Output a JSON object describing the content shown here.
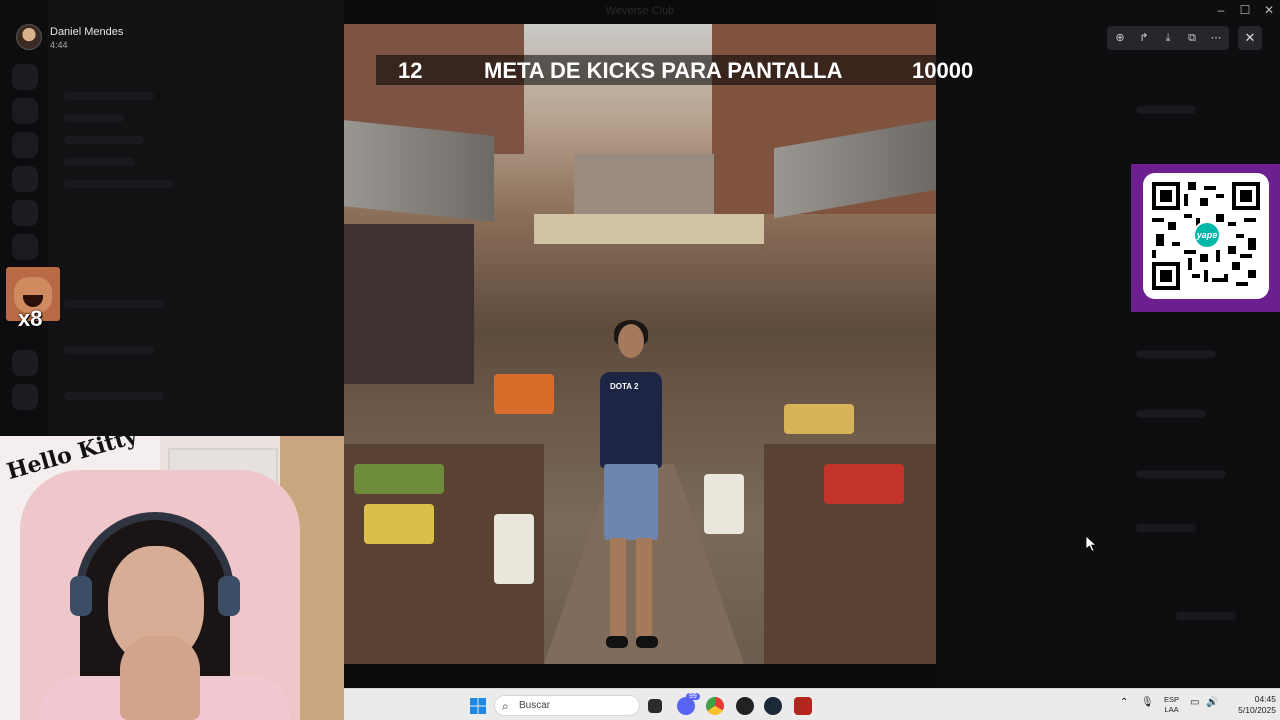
{
  "window": {
    "title": "Weverse Club"
  },
  "viewer": {
    "uploader_name": "Daniel Mendes",
    "uploader_time": "4:44",
    "toolbar": {
      "zoom_icon": "zoom-in-icon",
      "forward_icon": "forward-icon",
      "download_icon": "download-icon",
      "open_icon": "open-external-icon",
      "more_icon": "more-icon",
      "close_icon": "close-icon"
    }
  },
  "overlay": {
    "left_count": "12",
    "goal_text": "META DE KICKS PARA PANTALLA",
    "right_count": "10000",
    "emote_multiplier": "x8"
  },
  "photo": {
    "shirt_text": "DOTA 2"
  },
  "webcam": {
    "decor_text": "Hello Kitty"
  },
  "qr": {
    "logo_text": "yape"
  },
  "taskbar": {
    "search_placeholder": "Buscar",
    "apps": [
      "windows-start",
      "search",
      "task-view",
      "discord",
      "chrome",
      "obs",
      "steam",
      "dota2"
    ],
    "discord_badge": "99",
    "lang_top": "ESP",
    "lang_bottom": "LAA",
    "time": "04:45",
    "date": "5/10/2025"
  },
  "colors": {
    "qr_background": "#6d1f8f",
    "taskbar": "#ecebec",
    "discord": "#5865f2"
  }
}
